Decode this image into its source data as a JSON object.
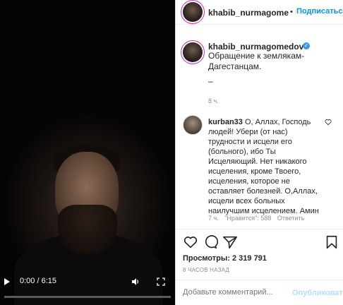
{
  "video": {
    "time": "0:00 / 6:15",
    "progress": 0
  },
  "header": {
    "username": "khabib_nurmagomedov",
    "follow_label": "Подписаться",
    "separator": "•"
  },
  "post": {
    "username": "khabib_nurmagomedov",
    "caption": "Обращение к землякам-Дагестанцам.",
    "dash": "–",
    "time": "8 ч."
  },
  "comment": {
    "username": "kurban33",
    "text": "О, Аллах, Господь людей! Убери (от нас) трудности и исцели его (больного), ибо Ты Исцеляющий. Нет никакого исцеления, кроме Твоего, исцеления, которое не оставляет болезней. О,Аллах, исцели всех больных наилучшим исцелением. Амин",
    "time": "7 ч.",
    "likes": "\"Нравится\": 588",
    "reply": "Ответить"
  },
  "stats": {
    "views_label": "Просмотры:",
    "views_count": "2 319 791",
    "ago": "8 ЧАСОВ НАЗАД"
  },
  "composer": {
    "placeholder": "Добавьте комментарий...",
    "publish": "Опубликовать"
  },
  "colors": {
    "accent": "#0095f6",
    "verified": "#3897f0"
  }
}
